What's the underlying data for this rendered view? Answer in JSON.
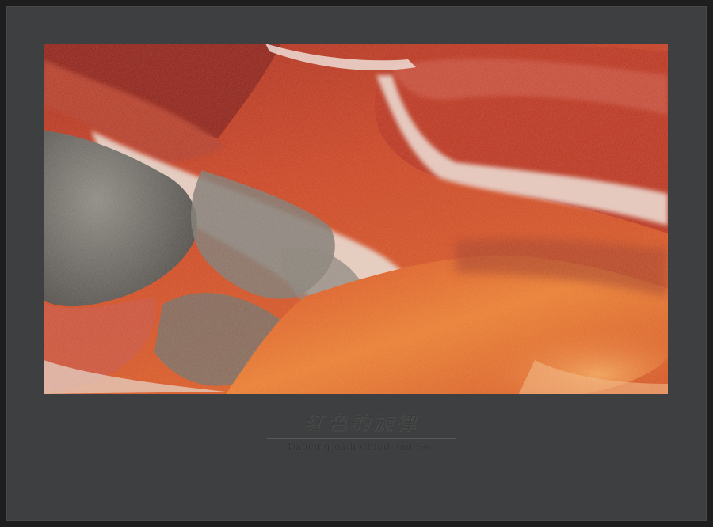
{
  "caption": {
    "title": "红色的旋律",
    "subtitle": "Dancing with Cloud and Sea"
  },
  "colors": {
    "outer_border": "#1e1e1e",
    "mat": "#3d3f40",
    "rock_red": "#b8321c",
    "rock_orange": "#e0651f",
    "rock_white": "#e9ddd2",
    "rock_grey": "#6d6a63"
  }
}
